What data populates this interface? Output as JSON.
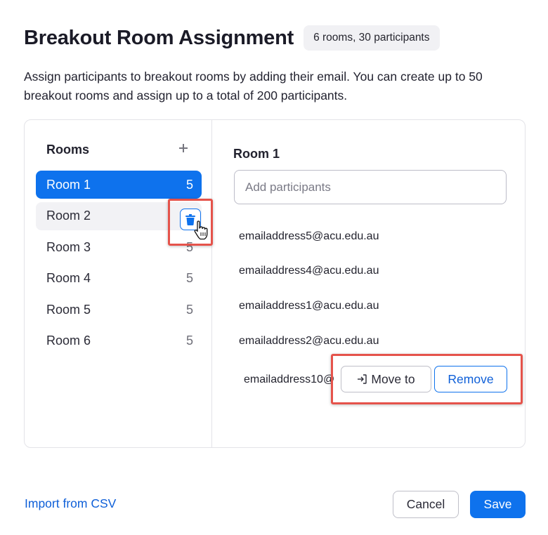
{
  "header": {
    "title": "Breakout Room Assignment",
    "badge": "6 rooms, 30 participants"
  },
  "description": "Assign participants to breakout rooms by adding their email. You can create up to 50 breakout rooms and assign up to a total of 200 participants.",
  "rooms_panel": {
    "heading": "Rooms",
    "add_icon": "plus-icon",
    "items": [
      {
        "label": "Room 1",
        "count": "5",
        "state": "selected"
      },
      {
        "label": "Room 2",
        "count": "",
        "state": "hover"
      },
      {
        "label": "Room 3",
        "count": "5",
        "state": "normal"
      },
      {
        "label": "Room 4",
        "count": "5",
        "state": "normal"
      },
      {
        "label": "Room 5",
        "count": "5",
        "state": "normal"
      },
      {
        "label": "Room 6",
        "count": "5",
        "state": "normal"
      }
    ],
    "delete_icon": "trash-icon",
    "cursor_icon": "hand-pointer-icon"
  },
  "detail": {
    "room_title": "Room 1",
    "add_placeholder": "Add participants",
    "participants": [
      "emailaddress5@acu.edu.au",
      "emailaddress4@acu.edu.au",
      "emailaddress1@acu.edu.au",
      "emailaddress2@acu.edu.au",
      "emailaddress10@"
    ],
    "move_label": "Move to",
    "move_icon": "move-to-icon",
    "remove_label": "Remove"
  },
  "footer": {
    "import_label": "Import from CSV",
    "cancel_label": "Cancel",
    "save_label": "Save"
  },
  "colors": {
    "accent": "#0e72ed",
    "highlight": "#e5534b"
  }
}
